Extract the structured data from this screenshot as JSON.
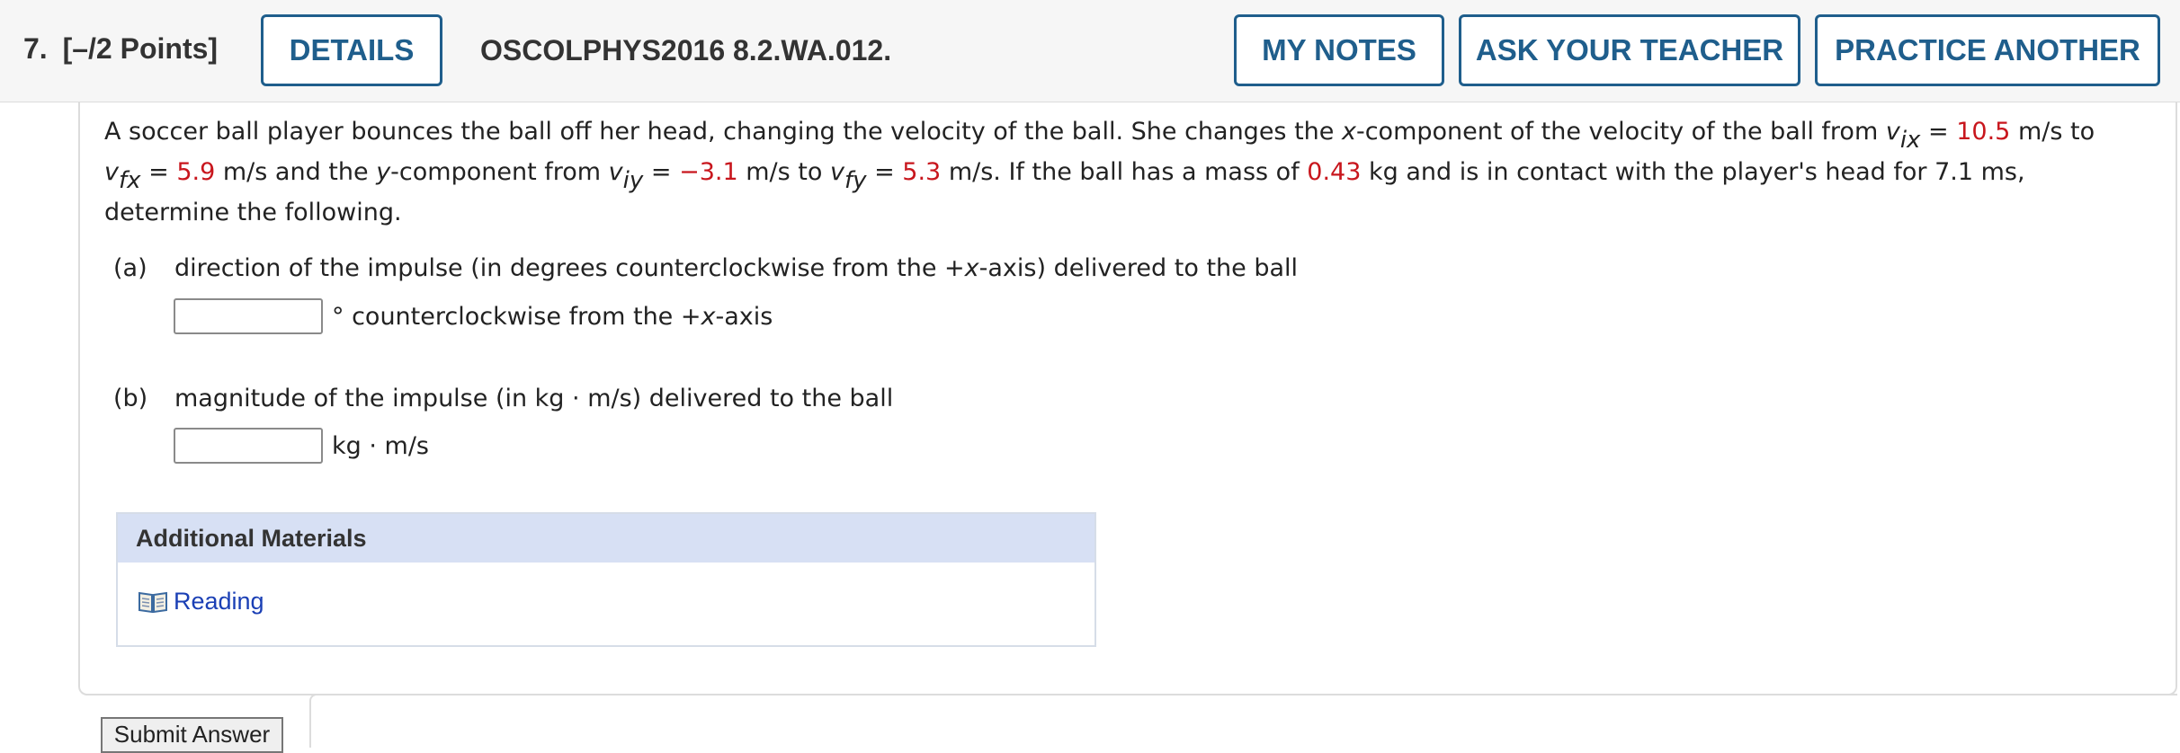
{
  "header": {
    "question_number": "7.",
    "points": "[–/2 Points]",
    "details_label": "DETAILS",
    "problem_code": "OSCOLPHYS2016 8.2.WA.012.",
    "my_notes_label": "MY NOTES",
    "ask_teacher_label": "ASK YOUR TEACHER",
    "practice_another_label": "PRACTICE ANOTHER"
  },
  "problem": {
    "text_1": "A soccer ball player bounces the ball off her head, changing the velocity of the ball. She changes the ",
    "x_var": "x",
    "text_2": "-component of the velocity of the ball from ",
    "v_symbol": "v",
    "sub_ix": "ix",
    "eq": " = ",
    "v_ix": "10.5",
    "unit_to": " m/s to",
    "sub_fx": "fx",
    "v_fx": "5.9",
    "text_3": " m/s and the ",
    "y_var": "y",
    "text_4": "-component from ",
    "sub_iy": "iy",
    "v_iy": "−3.1",
    "text_5": " m/s to ",
    "sub_fy": "fy",
    "v_fy": "5.3",
    "text_6": " m/s. If the ball has a mass of ",
    "mass": "0.43",
    "text_7": " kg and is in contact with the player's head for 7.1 ms, determine the following."
  },
  "part_a": {
    "label": "(a)",
    "prompt_1": "direction of the impulse (in degrees counterclockwise from the +",
    "prompt_x": "x",
    "prompt_2": "-axis) delivered to the ball",
    "unit_1": "° counterclockwise from the +",
    "unit_x": "x",
    "unit_2": "-axis",
    "answer_value": ""
  },
  "part_b": {
    "label": "(b)",
    "prompt": "magnitude of the impulse (in kg · m/s) delivered to the ball",
    "unit": "kg · m/s",
    "answer_value": ""
  },
  "materials": {
    "heading": "Additional Materials",
    "reading_label": "Reading",
    "reading_icon": "book-icon"
  },
  "submit_label": "Submit Answer",
  "colors": {
    "accent": "#1f5e8c",
    "red_value": "#c8161d",
    "link": "#1a3fb5",
    "materials_header": "#d7e0f4"
  }
}
